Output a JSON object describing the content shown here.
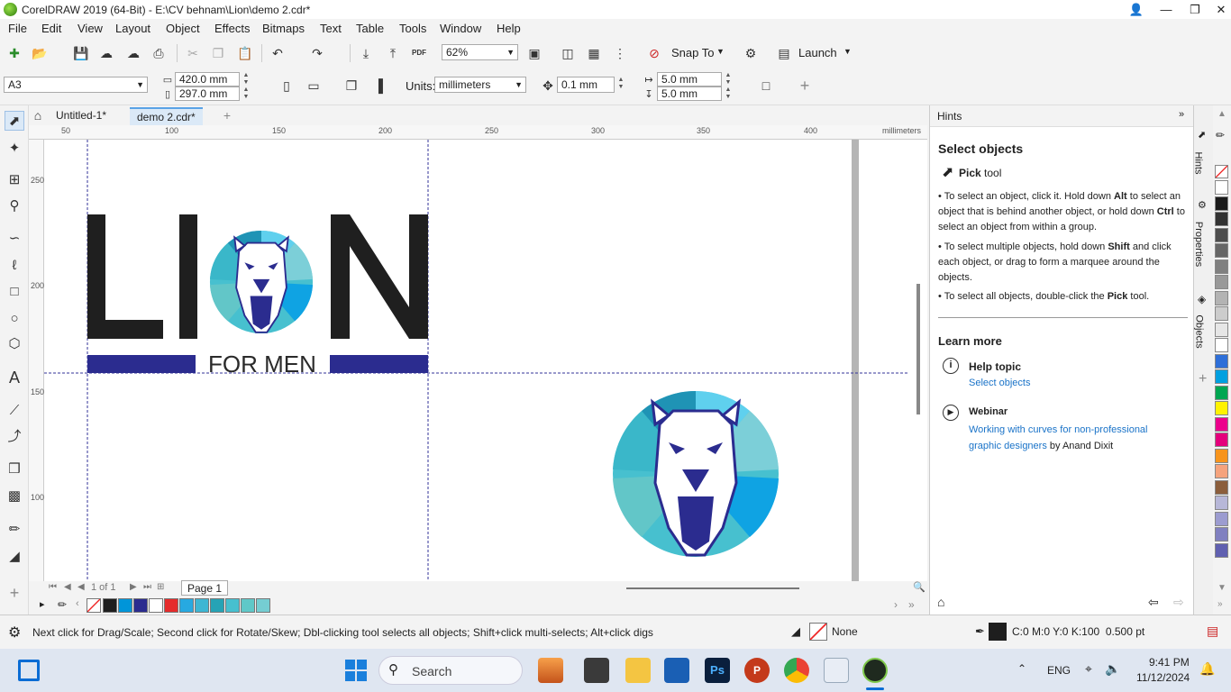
{
  "window": {
    "title": "CorelDRAW 2019 (64-Bit) - E:\\CV behnam\\Lion\\demo 2.cdr*"
  },
  "menu": [
    "File",
    "Edit",
    "View",
    "Layout",
    "Object",
    "Effects",
    "Bitmaps",
    "Text",
    "Table",
    "Tools",
    "Window",
    "Help"
  ],
  "toolbar": {
    "zoom": "62%",
    "snap_to": "Snap To",
    "launch": "Launch",
    "pdf_label": "PDF"
  },
  "propbar": {
    "page_size": "A3",
    "width": "420.0 mm",
    "height": "297.0 mm",
    "units_label": "Units:",
    "units": "millimeters",
    "nudge": "0.1 mm",
    "dup_x": "5.0 mm",
    "dup_y": "5.0 mm"
  },
  "doc_tabs": [
    "Untitled-1*",
    "demo 2.cdr*"
  ],
  "ruler": {
    "h_labels": [
      "50",
      "100",
      "150",
      "200",
      "250",
      "300",
      "350",
      "400"
    ],
    "unit": "millimeters",
    "v_labels": [
      "250",
      "200",
      "150",
      "100"
    ]
  },
  "artwork": {
    "word": "LION",
    "tagline": "FOR MEN"
  },
  "pagebar": {
    "page_of": "1 of 1",
    "page_tab": "Page 1"
  },
  "palette_colors": [
    "#1e1e1e",
    "#0095d9",
    "#2b2c8f",
    "#ffffff",
    "#e52b2b",
    "#27a9e1",
    "#3db6d3",
    "#26a3b5",
    "#47c0cf",
    "#5fc8c8",
    "#75cdd2"
  ],
  "right_palette": [
    "#ffffff",
    "#1a1a1a",
    "#333333",
    "#4d4d4d",
    "#666666",
    "#808080",
    "#999999",
    "#b3b3b3",
    "#cccccc",
    "#e6e6e6",
    "#ffffff",
    "#2e6fd8",
    "#00a0e0",
    "#00a651",
    "#fff200",
    "#ec008c",
    "#e4007c",
    "#f7941d",
    "#f5a37d",
    "#8b5e3c",
    "#b7b7d8",
    "#9c9cd0",
    "#8080c0",
    "#6060b0"
  ],
  "docker": {
    "title": "Hints",
    "heading": "Select objects",
    "tool_bold": "Pick",
    "tool_rest": " tool",
    "bullets": [
      {
        "a": "To select an object, click it. Hold down ",
        "b": "Alt",
        "c": " to select an object that is behind another object, or hold down ",
        "d": "Ctrl",
        "e": " to select an object from within a group."
      },
      {
        "a": "To select multiple objects, hold down ",
        "b": "Shift",
        "c": " and click each object, or drag to form a marquee around the objects.",
        "d": "",
        "e": ""
      },
      {
        "a": "To select all objects, double-click the ",
        "b": "Pick",
        "c": " tool.",
        "d": "",
        "e": ""
      }
    ],
    "learn_more": "Learn more",
    "help_topic": "Help topic",
    "help_link": "Select objects",
    "webinar": "Webinar",
    "webinar_link": "Working with curves for non-professional graphic designers",
    "webinar_by": " by Anand Dixit",
    "tabs": [
      "Hints",
      "Properties",
      "Objects"
    ]
  },
  "status": {
    "hint": "Next click for Drag/Scale; Second click for Rotate/Skew; Dbl-clicking tool selects all objects; Shift+click multi-selects; Alt+click digs",
    "fill": "None",
    "outline": "C:0 M:0 Y:0 K:100  0.500 pt"
  },
  "taskbar": {
    "search": "Search",
    "lang": "ENG",
    "time": "9:41 PM",
    "date": "11/12/2024"
  }
}
